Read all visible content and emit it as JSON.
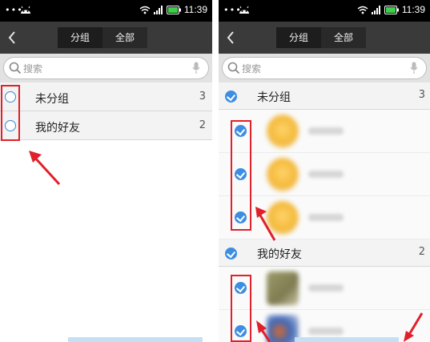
{
  "status": {
    "dots": "•••",
    "time": "11:39"
  },
  "titlebar": {
    "tabs": [
      {
        "label": "分组",
        "active": true
      },
      {
        "label": "全部",
        "active": false
      }
    ]
  },
  "search": {
    "placeholder": "搜索"
  },
  "left_screen": {
    "groups": [
      {
        "name": "未分组",
        "count": "3",
        "selected": false
      },
      {
        "name": "我的好友",
        "count": "2",
        "selected": false
      }
    ]
  },
  "right_screen": {
    "groups": [
      {
        "name": "未分组",
        "count": "3",
        "selected": true,
        "members": 3
      },
      {
        "name": "我的好友",
        "count": "2",
        "selected": true,
        "members": 2
      }
    ]
  },
  "colors": {
    "accent": "#3b8ee2",
    "annotation": "#e0202a",
    "titlebar": "#3a3a3a"
  },
  "icons": [
    "android-icon",
    "wifi-icon",
    "signal-icon",
    "battery-icon",
    "back-icon",
    "search-icon",
    "microphone-icon",
    "check-icon",
    "arrow-annotation"
  ]
}
